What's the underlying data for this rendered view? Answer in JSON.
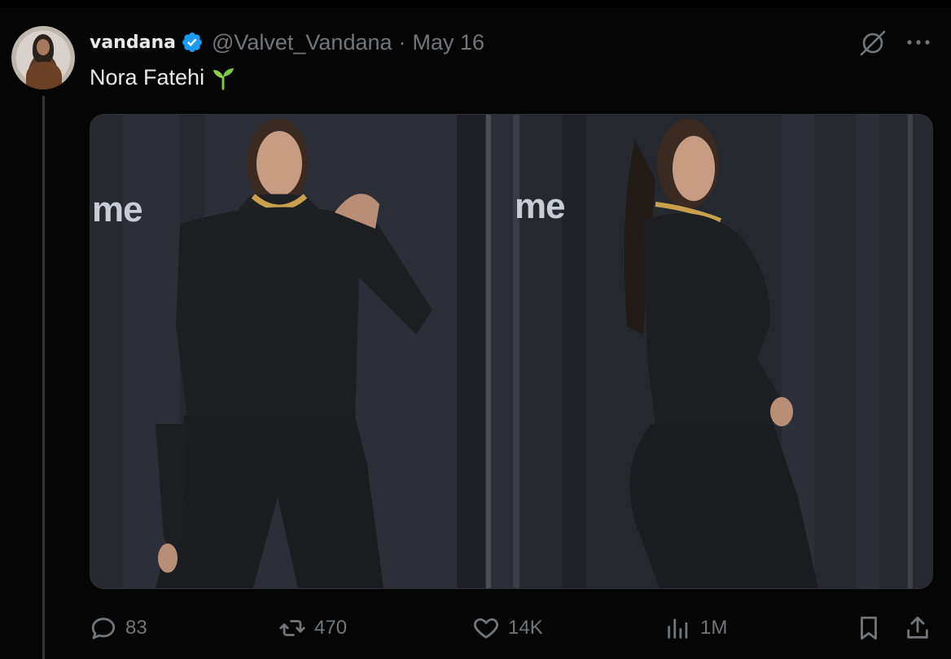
{
  "tweet": {
    "author": {
      "display_name": "vandana",
      "handle": "@Valvet_Vandana",
      "verified": true,
      "verified_color": "#1d9bf0"
    },
    "separator": "·",
    "date": "May 16",
    "text": "Nora Fatehi",
    "emoji": "seedling-icon",
    "media": [
      {
        "overlay_text": "me"
      },
      {
        "overlay_text": "me"
      }
    ],
    "actions": {
      "replies": "83",
      "reposts": "470",
      "likes": "14K",
      "views": "1M"
    }
  },
  "colors": {
    "background": "#050505",
    "text_primary": "#e7e9ea",
    "text_secondary": "#71767b",
    "thread_line": "#333639",
    "emoji_green": "#7cc44a"
  }
}
